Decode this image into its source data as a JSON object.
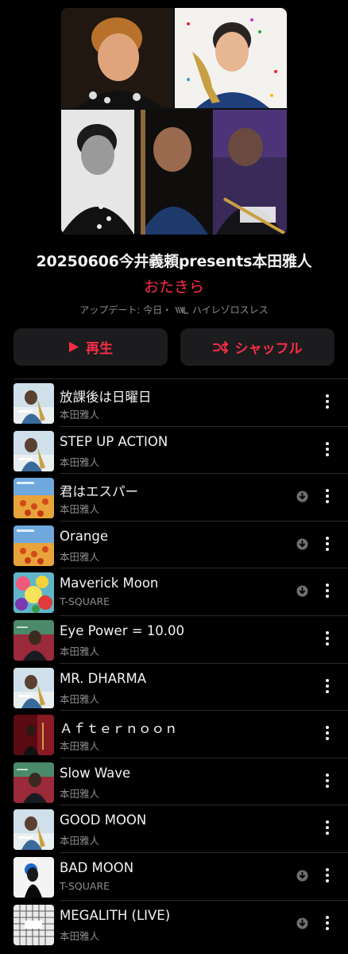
{
  "playlist": {
    "title": "20250606今井義頼presents本田雅人",
    "curator": "おたきら",
    "updated_label": "アップデート: 今日・",
    "quality_icon": "hi-res-lossless-icon",
    "quality_label": "ハイレゾロスレス"
  },
  "controls": {
    "play_label": "再生",
    "shuffle_label": "シャッフル"
  },
  "tracks": [
    {
      "title": "放課後は日曜日",
      "artist": "本田雅人",
      "downloaded": false,
      "art": "sax"
    },
    {
      "title": "STEP UP ACTION",
      "artist": "本田雅人",
      "downloaded": false,
      "art": "sax"
    },
    {
      "title": "君はエスパー",
      "artist": "本田雅人",
      "downloaded": true,
      "art": "orange"
    },
    {
      "title": "Orange",
      "artist": "本田雅人",
      "downloaded": true,
      "art": "orange"
    },
    {
      "title": "Maverick Moon",
      "artist": "T-SQUARE",
      "downloaded": true,
      "art": "maverick"
    },
    {
      "title": "Eye Power = 10.00",
      "artist": "本田雅人",
      "downloaded": false,
      "art": "red"
    },
    {
      "title": "MR. DHARMA",
      "artist": "本田雅人",
      "downloaded": false,
      "art": "sax"
    },
    {
      "title": "Ａｆｔｅｒｎｏｏｎ",
      "artist": "本田雅人",
      "downloaded": false,
      "art": "darkred"
    },
    {
      "title": "Slow Wave",
      "artist": "本田雅人",
      "downloaded": false,
      "art": "red"
    },
    {
      "title": "GOOD MOON",
      "artist": "本田雅人",
      "downloaded": false,
      "art": "sax"
    },
    {
      "title": "BAD MOON",
      "artist": "T-SQUARE",
      "downloaded": true,
      "art": "badmoon"
    },
    {
      "title": "MEGALITH (LIVE)",
      "artist": "本田雅人",
      "downloaded": true,
      "art": "grid"
    }
  ],
  "colors": {
    "accent": "#fa2d48",
    "background": "#000000",
    "button_bg": "#1c1c1e",
    "secondary_text": "#8d8d92"
  }
}
